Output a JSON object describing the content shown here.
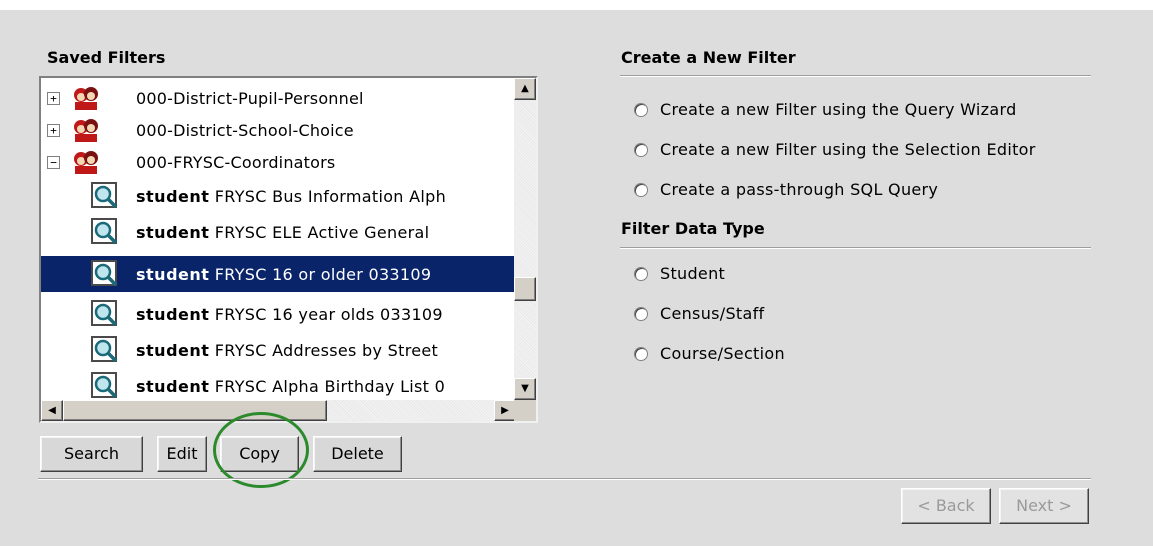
{
  "saved_filters": {
    "title": "Saved Filters",
    "items": [
      {
        "type": "group",
        "expander": "+",
        "label": "000-District-Pupil-Personnel"
      },
      {
        "type": "group",
        "expander": "+",
        "label": "000-District-School-Choice"
      },
      {
        "type": "group",
        "expander": "−",
        "label": "000-FRYSC-Coordinators"
      },
      {
        "type": "query",
        "prefix": "student",
        "label": " FRYSC Bus Information Alph"
      },
      {
        "type": "query",
        "prefix": "student",
        "label": " FRYSC ELE Active General "
      },
      {
        "type": "query",
        "prefix": "student",
        "label": " FRYSC 16 or older 033109",
        "selected": true
      },
      {
        "type": "query",
        "prefix": "student",
        "label": " FRYSC 16 year olds 033109"
      },
      {
        "type": "query",
        "prefix": "student",
        "label": " FRYSC Addresses by Street"
      },
      {
        "type": "query",
        "prefix": "student",
        "label": " FRYSC Alpha Birthday List 0"
      }
    ],
    "buttons": {
      "search": "Search",
      "edit": "Edit",
      "copy": "Copy",
      "delete": "Delete"
    }
  },
  "new_filter": {
    "title": "Create a New Filter",
    "options": [
      "Create a new Filter using the Query Wizard",
      "Create a new Filter using the Selection Editor",
      "Create a pass-through SQL Query"
    ]
  },
  "data_type": {
    "title": "Filter Data Type",
    "options": [
      "Student",
      "Census/Staff",
      "Course/Section"
    ]
  },
  "nav": {
    "back": "< Back",
    "next": "Next >"
  },
  "colors": {
    "selection": "#0a246a",
    "highlight_ring": "#2b8a2b",
    "panel": "#dddddd"
  }
}
